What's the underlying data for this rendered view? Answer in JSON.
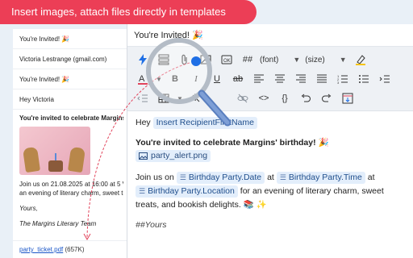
{
  "banner": {
    "text": "Insert images, attach files directly in templates"
  },
  "preview": {
    "subject": "You're Invited! 🎉",
    "from": "Victoria Lestrange (gmail.com)",
    "subject2": "You're Invited! 🎉",
    "greeting": "Hey Victoria",
    "heading": "You're invited to celebrate Margins' bi",
    "line1": "Join us on 21.08.2025 at 16:00 at 5 Vy",
    "line2": "an evening of literary charm, sweet tre",
    "sign1": "Yours,",
    "sign2": "The Margins Literary Team",
    "attachment_name": "party_ticket.pdf",
    "attachment_size": "(657K)"
  },
  "editor": {
    "subject": "You're Invited! 🎉",
    "toolbar": {
      "font_select": "(font)",
      "size_select": "(size)",
      "hash_label": "##"
    },
    "content": {
      "hey": "Hey",
      "recipient_chip": "Insert RecipientFirstName",
      "heading": "You're invited to celebrate Margins' birthday! 🎉",
      "image_chip": "party_alert.png",
      "join_prefix": "Join us on",
      "date_chip": "Birthday Party.Date",
      "at1": "at",
      "time_chip": "Birthday Party.Time",
      "at2": "at",
      "location_chip": "Birthday Party.Location",
      "join_suffix": "for an evening of literary charm, sweet treats, and bookish delights. 📚 ✨",
      "signoff": "##Yours"
    }
  },
  "colors": {
    "banner": "#ec3e56",
    "chip_bg": "#e3eefb",
    "link": "#1a56c8",
    "accent": "#1f6fe5"
  }
}
